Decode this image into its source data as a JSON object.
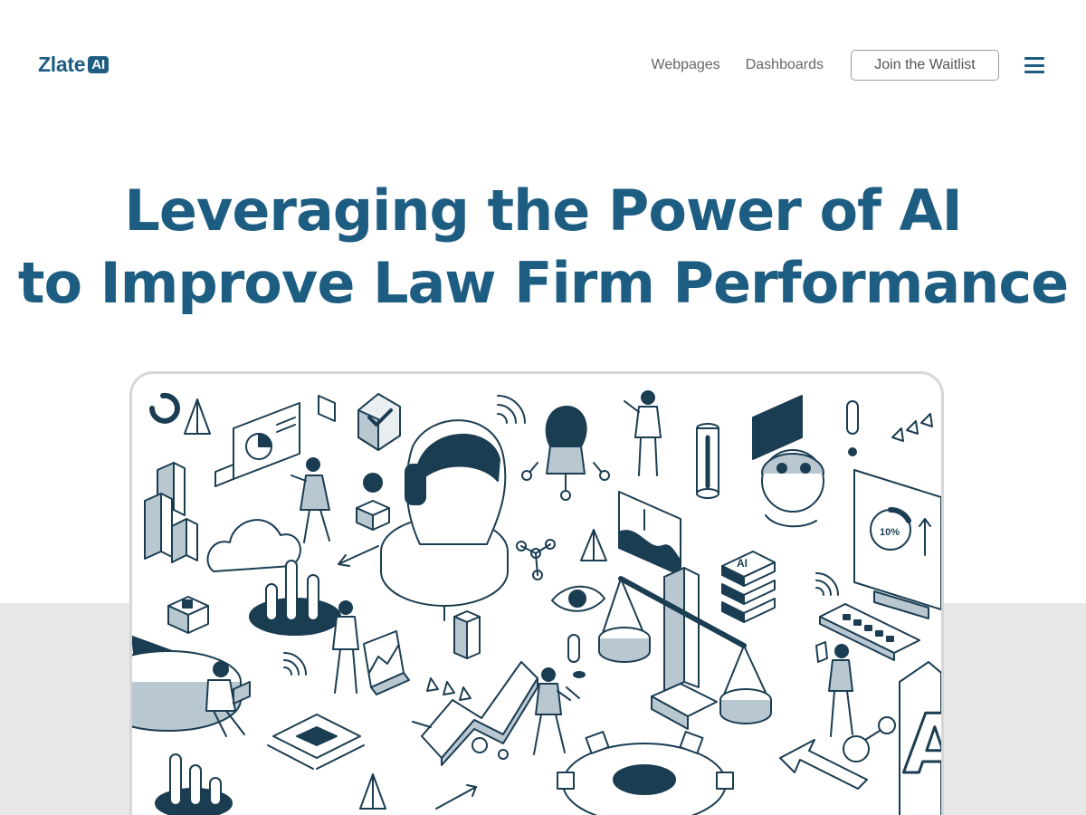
{
  "header": {
    "logo_text": "Zlate",
    "logo_badge": "AI",
    "nav": {
      "webpages": "Webpages",
      "dashboards": "Dashboards"
    },
    "waitlist_label": "Join the Waitlist",
    "menu_icon": "hamburger-menu-icon"
  },
  "hero": {
    "title_line1": "Leveraging the Power of AI",
    "title_line2": "to Improve Law Firm Performance"
  },
  "illustration": {
    "monitor_readout": "10%",
    "ai_block_label": "AI",
    "big_letter": "A"
  },
  "colors": {
    "brand": "#1d5d82",
    "ink": "#1b3d52",
    "nav_text": "#666666",
    "button_border": "#9a9a9a",
    "band_gray": "#e8e8e8",
    "card_border": "#d6d6d6"
  }
}
